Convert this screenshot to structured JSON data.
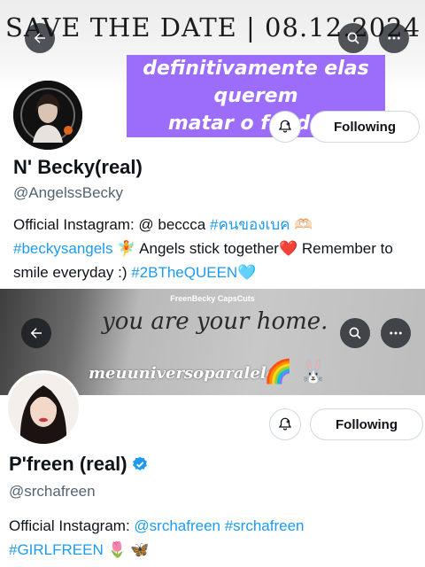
{
  "profile1": {
    "banner_text": "SAVE THE DATE | 08.12.2024",
    "caption_line1": "definitivamente elas querem",
    "caption_line2": "matar o fandom",
    "name": "N' Becky(real)",
    "handle": "@AngelssBecky",
    "follow_label": "Following",
    "bio": {
      "t1": "Official Instagram: @ beccca ",
      "h1": "#คนของเบค",
      "e1": " 🫶🏻",
      "h2": "#beckysangels",
      "t2": " 🧚 Angels stick together",
      "e2": "❤️",
      "t3": " Remember to smile everyday :) ",
      "h3": "#2BTheQUEEN",
      "e3": "🩵"
    }
  },
  "profile2": {
    "banner_credit": "FreenBecky CapsCuts",
    "banner_quote": "you are your home.",
    "banner_handle": "meuuniversoparalelo",
    "banner_emojis": "🌈 🐰",
    "name": "P'freen (real)",
    "handle": "@srchafreen",
    "follow_label": "Following",
    "bio": {
      "t1": "Official Instagram: ",
      "h1": "@srchafreen",
      "h2": "#srchafreen",
      "h3": "#GIRLFREEN",
      "e1": " 🌷 🦋"
    }
  },
  "colors": {
    "accent": "#1d9bf0",
    "caption_bg": "#9b6dfa",
    "verified": "#1d9bf0"
  },
  "icons": [
    "back-arrow-icon",
    "search-icon",
    "more-icon",
    "notification-bell-icon",
    "verified-badge-icon"
  ]
}
